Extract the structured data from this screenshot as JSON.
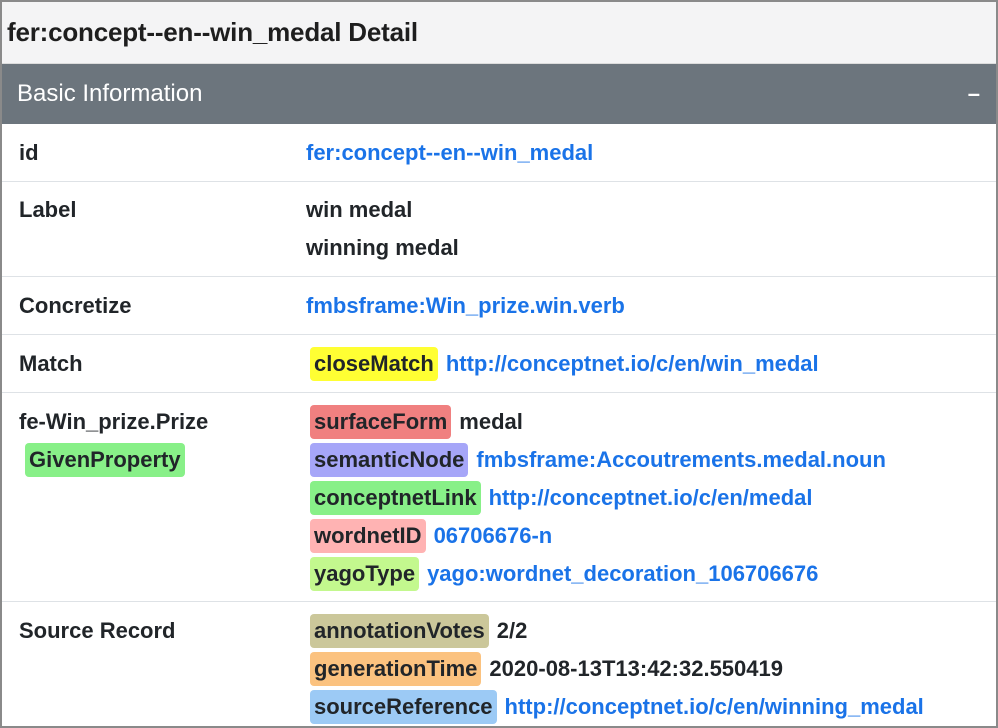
{
  "page": {
    "title": "fer:concept--en--win_medal Detail"
  },
  "section": {
    "title": "Basic Information",
    "collapse_symbol": "–"
  },
  "rows": {
    "id": {
      "key": "id",
      "value": "fer:concept--en--win_medal"
    },
    "label": {
      "key": "Label",
      "values": [
        "win medal",
        "winning medal"
      ]
    },
    "concretize": {
      "key": "Concretize",
      "value": "fmbsframe:Win_prize.win.verb"
    },
    "match": {
      "key": "Match",
      "tag": "closeMatch",
      "tag_color": "#ffff33",
      "value": "http://conceptnet.io/c/en/win_medal"
    },
    "fe": {
      "key": "fe-Win_prize.Prize",
      "key_tag": "GivenProperty",
      "key_tag_color": "#88f088",
      "items": [
        {
          "tag": "surfaceForm",
          "color": "#f08080",
          "value": "medal",
          "link": false
        },
        {
          "tag": "semanticNode",
          "color": "#a6a6f8",
          "value": "fmbsframe:Accoutrements.medal.noun",
          "link": true
        },
        {
          "tag": "conceptnetLink",
          "color": "#88f088",
          "value": "http://conceptnet.io/c/en/medal",
          "link": true
        },
        {
          "tag": "wordnetID",
          "color": "#ffb3b3",
          "value": "06706676-n",
          "link": true
        },
        {
          "tag": "yagoType",
          "color": "#c3f88e",
          "value": "yago:wordnet_decoration_106706676",
          "link": true
        }
      ]
    },
    "source": {
      "key": "Source Record",
      "items": [
        {
          "tag": "annotationVotes",
          "color": "#cbc79a",
          "value": "2/2",
          "link": false
        },
        {
          "tag": "generationTime",
          "color": "#fbc27f",
          "value": "2020-08-13T13:42:32.550419",
          "link": false
        },
        {
          "tag": "sourceReference",
          "color": "#9ccaf5",
          "value": "http://conceptnet.io/c/en/winning_medal",
          "link": true
        }
      ]
    }
  }
}
